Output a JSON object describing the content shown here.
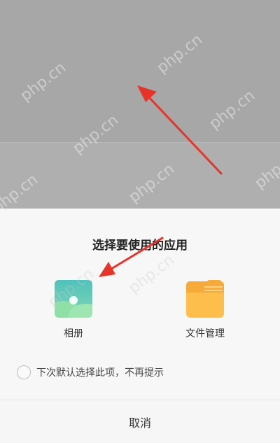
{
  "dialog": {
    "title": "选择要使用的应用",
    "options": [
      {
        "label": "相册",
        "icon": "photo-gallery-icon"
      },
      {
        "label": "文件管理",
        "icon": "folder-icon"
      }
    ],
    "remember_label": "下次默认选择此项，不再提示",
    "cancel_label": "取消"
  },
  "watermark": "php.cn",
  "colors": {
    "overlay": "#a8a8a8",
    "sheet_bg": "#f7f7f7",
    "arrow": "#e8332a",
    "gallery_teal": "#4fc2bb",
    "folder_orange": "#f6aa3a"
  }
}
